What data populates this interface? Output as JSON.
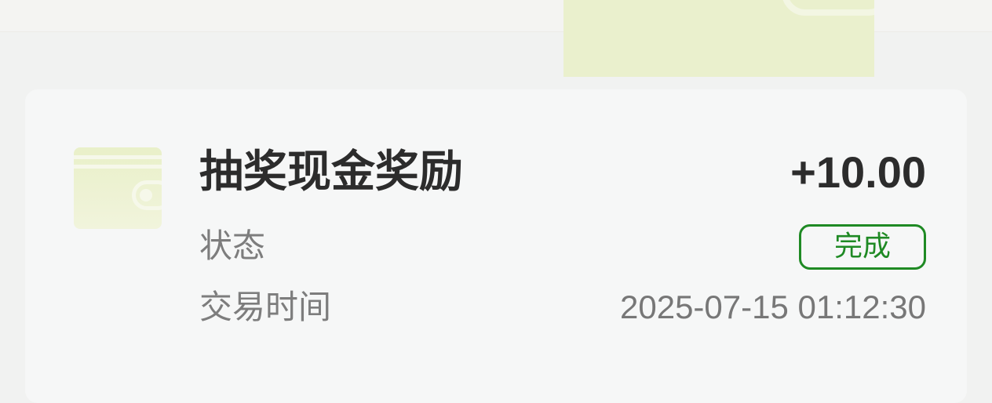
{
  "transaction": {
    "title": "抽奖现金奖励",
    "amount": "+10.00",
    "status_label": "状态",
    "status_value": "完成",
    "time_label": "交易时间",
    "time_value": "2025-07-15 01:12:30"
  },
  "icons": {
    "top_wallet": "wallet-icon",
    "item_wallet": "wallet-icon"
  },
  "colors": {
    "status_green": "#1f8a24",
    "wallet_fill": "#e9f0c9",
    "card_background": "#f6f7f7",
    "text_primary": "#2c2c2c",
    "text_secondary": "#7d7d7d"
  }
}
